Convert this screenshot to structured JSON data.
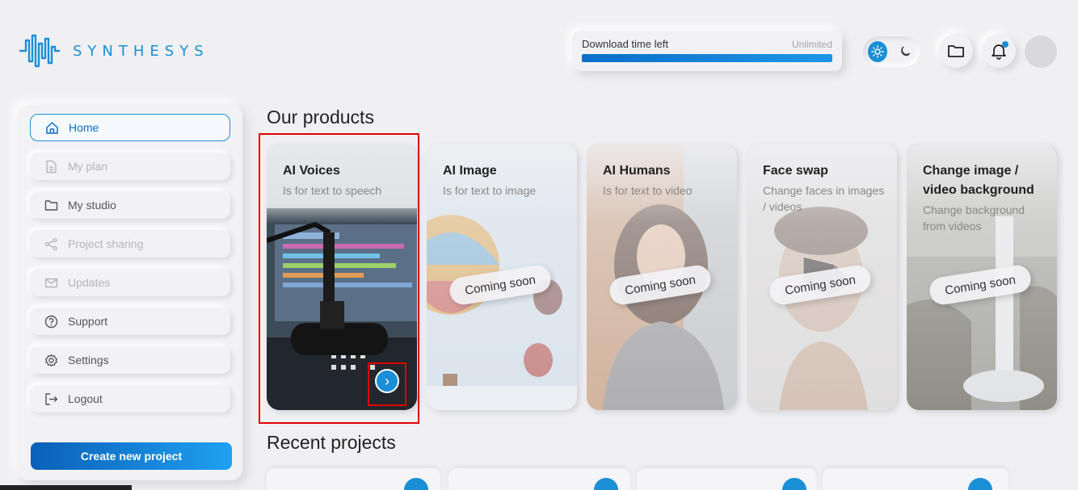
{
  "brand": {
    "name": "SYNTHESYS"
  },
  "download": {
    "label": "Download time left",
    "value": "Unlimited",
    "progress": 1.0
  },
  "header": {
    "theme_light_icon": "sun-icon",
    "theme_dark_icon": "moon-icon",
    "folder_icon": "folder-icon",
    "bell_icon": "bell-icon"
  },
  "sidebar": {
    "items": [
      {
        "label": "Home",
        "icon": "home-icon",
        "state": "active"
      },
      {
        "label": "My plan",
        "icon": "document-icon",
        "state": "disabled"
      },
      {
        "label": "My studio",
        "icon": "folder-icon",
        "state": "normal"
      },
      {
        "label": "Project sharing",
        "icon": "share-icon",
        "state": "disabled"
      },
      {
        "label": "Updates",
        "icon": "mail-icon",
        "state": "disabled"
      },
      {
        "label": "Support",
        "icon": "help-icon",
        "state": "normal"
      },
      {
        "label": "Settings",
        "icon": "gear-icon",
        "state": "normal"
      },
      {
        "label": "Logout",
        "icon": "logout-icon",
        "state": "normal"
      }
    ],
    "create_button": "Create new project"
  },
  "products": {
    "title": "Our products",
    "cards": [
      {
        "title": "AI Voices",
        "subtitle": "Is for text to speech",
        "badge": "",
        "image": "studio-microphone"
      },
      {
        "title": "AI Image",
        "subtitle": "Is for text to image",
        "badge": "Coming soon",
        "image": "hot-air-balloons"
      },
      {
        "title": "AI Humans",
        "subtitle": "Is for text to video",
        "badge": "Coming soon",
        "image": "smiling-woman"
      },
      {
        "title": "Face swap",
        "subtitle": "Change faces in images / videos",
        "badge": "Coming soon",
        "image": "face-scan"
      },
      {
        "title": "Change image / video background",
        "subtitle": "Change background from videos",
        "badge": "Coming soon",
        "image": "waterfall"
      }
    ],
    "next_arrow": "›"
  },
  "recent": {
    "title": "Recent projects"
  },
  "colors": {
    "accent": "#1a8fd6",
    "accent_dark": "#0a60b8",
    "background": "#f0f0f3",
    "highlight": "#e00000"
  }
}
